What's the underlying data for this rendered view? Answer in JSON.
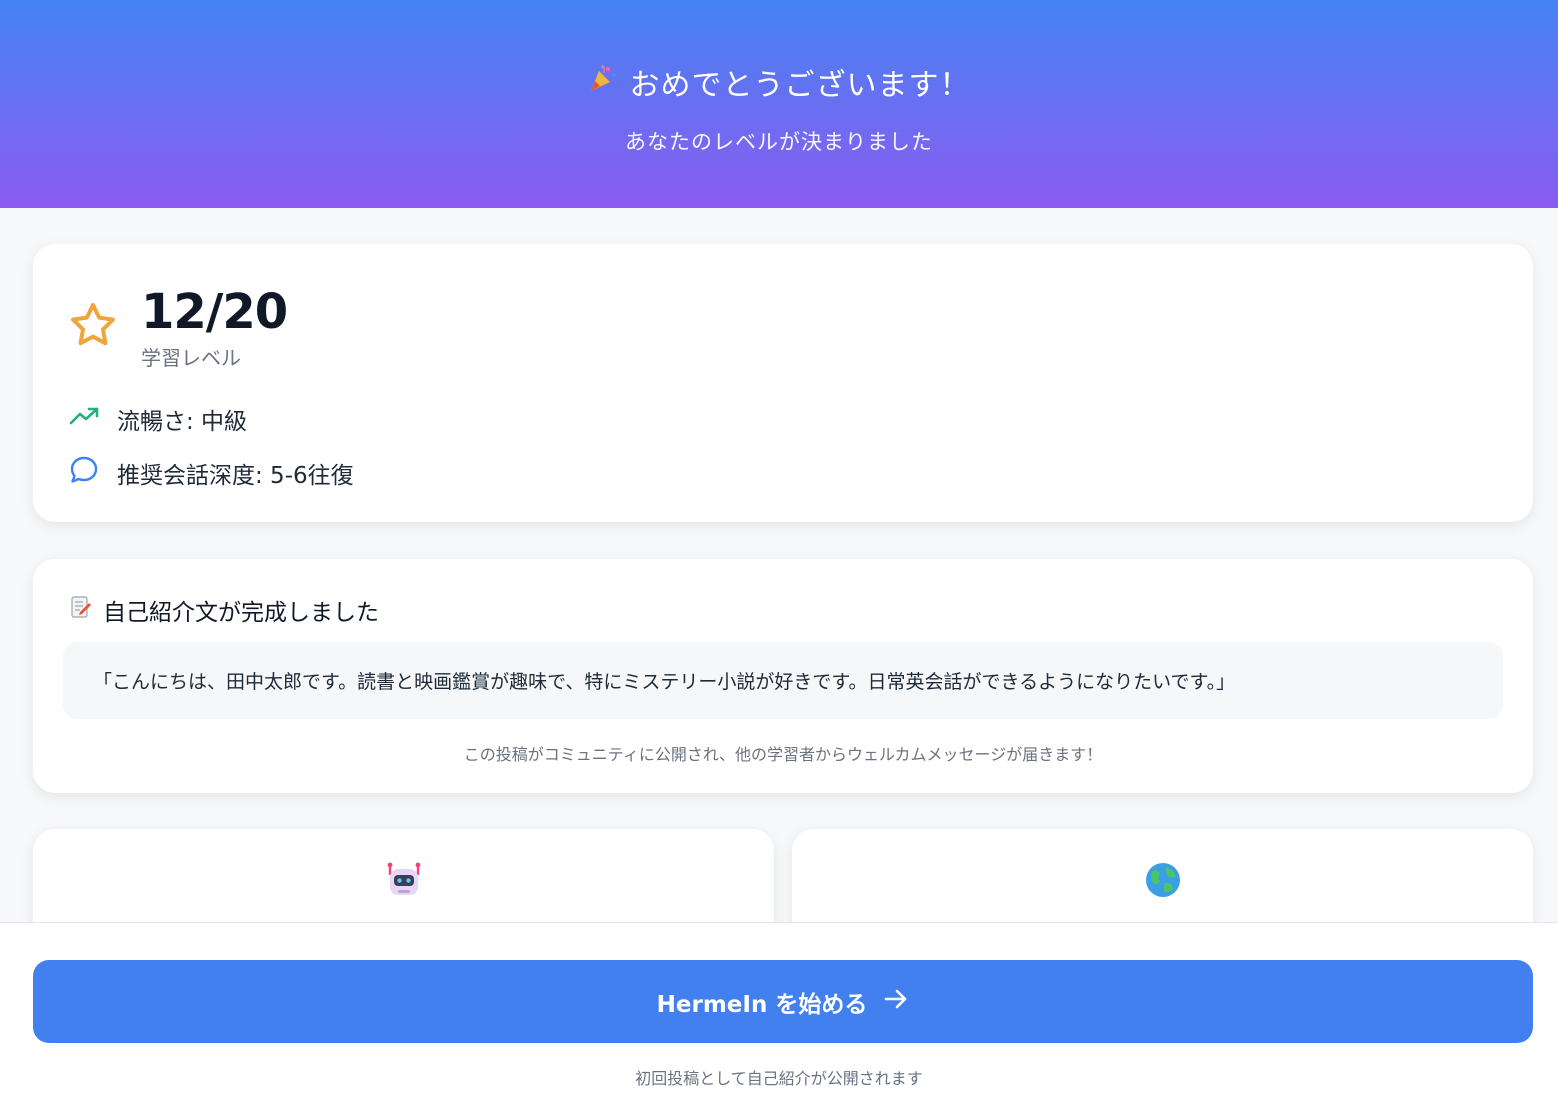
{
  "header": {
    "title": "おめでとうございます！",
    "subtitle": "あなたのレベルが決まりました"
  },
  "level_card": {
    "score": "12/20",
    "score_label": "学習レベル",
    "fluency": "流暢さ: 中級",
    "depth": "推奨会話深度: 5-6往復"
  },
  "intro_card": {
    "title": "自己紹介文が完成しました",
    "text": "「こんにちは、田中太郎です。読書と映画鑑賞が趣味で、特にミステリー小説が好きです。日常英会話ができるようになりたいです。」",
    "note": "この投稿がコミュニティに公開され、他の学習者からウェルカムメッセージが届きます！"
  },
  "feature_cards": [
    {
      "icon": "robot-icon",
      "label": ""
    },
    {
      "icon": "globe-icon",
      "label": ""
    }
  ],
  "footer": {
    "cta_label": "HermeIn を始める",
    "note": "初回投稿として自己紹介が公開されます"
  },
  "colors": {
    "header_top": "#4583f2",
    "header_bottom": "#8b5cf0",
    "cta": "#4280f0",
    "star": "#f0a43a",
    "trend": "#22b07d",
    "chat": "#3b82f6"
  }
}
